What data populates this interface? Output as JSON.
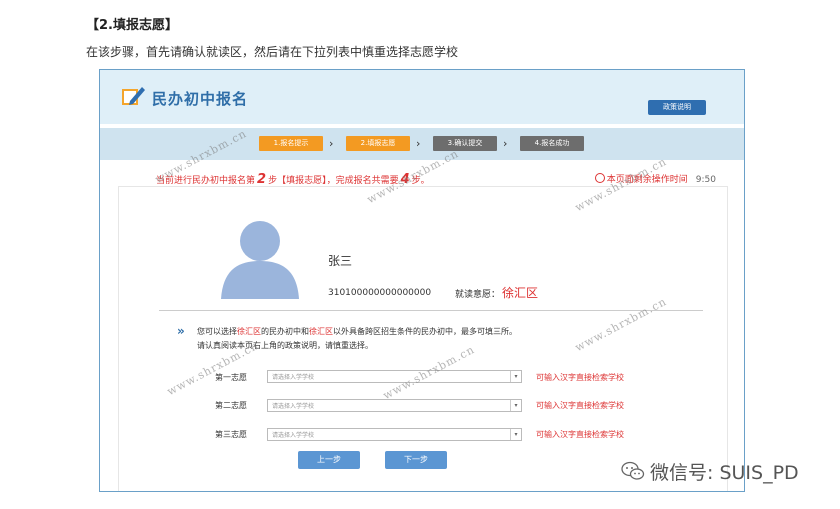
{
  "article": {
    "heading": "【2.填报志愿】",
    "subtext": "在该步骤，首先请确认就读区，然后请在下拉列表中慎重选择志愿学校"
  },
  "header": {
    "logo_text": "民办初中报名",
    "policy_button": "政策说明"
  },
  "steps": [
    {
      "label": "1.报名提示",
      "state": "done"
    },
    {
      "label": "2.填报志愿",
      "state": "current"
    },
    {
      "label": "3.确认提交",
      "state": "todo"
    },
    {
      "label": "4.报名成功",
      "state": "todo"
    }
  ],
  "status": {
    "prefix": "当前进行民办初中报名第",
    "current_step": "2",
    "middle": "步【填报志愿】，完成报名共需要",
    "total_steps": "4",
    "suffix": "步。",
    "timer_label": "本页面剩余操作时间",
    "timer_value": "9:50"
  },
  "student": {
    "name": "张三",
    "id_number": "310100000000000000",
    "district_label": "就读意愿：",
    "district_value": "徐汇区"
  },
  "notice": {
    "part1": "您可以选择",
    "district1": "徐汇区",
    "part2": "的民办初中和",
    "district2": "徐汇区",
    "part3": "以外具备跨区招生条件的民办初中，最多可填三所。",
    "line2": "请认真阅读本页右上角的政策说明，请慎重选择。"
  },
  "choices": [
    {
      "label": "第一志愿",
      "placeholder": "请选择入学学校",
      "hint": "可输入汉字直接检索学校"
    },
    {
      "label": "第二志愿",
      "placeholder": "请选择入学学校",
      "hint": "可输入汉字直接检索学校"
    },
    {
      "label": "第三志愿",
      "placeholder": "请选择入学学校",
      "hint": "可输入汉字直接检索学校"
    }
  ],
  "buttons": {
    "prev": "上一步",
    "next": "下一步"
  },
  "watermark": "www.shrxbm.cn",
  "wechat_caption": "微信号: SUIS_PD",
  "colors": {
    "accent_orange": "#f39a22",
    "primary_blue": "#2f6eb0",
    "warning_red": "#d33"
  }
}
